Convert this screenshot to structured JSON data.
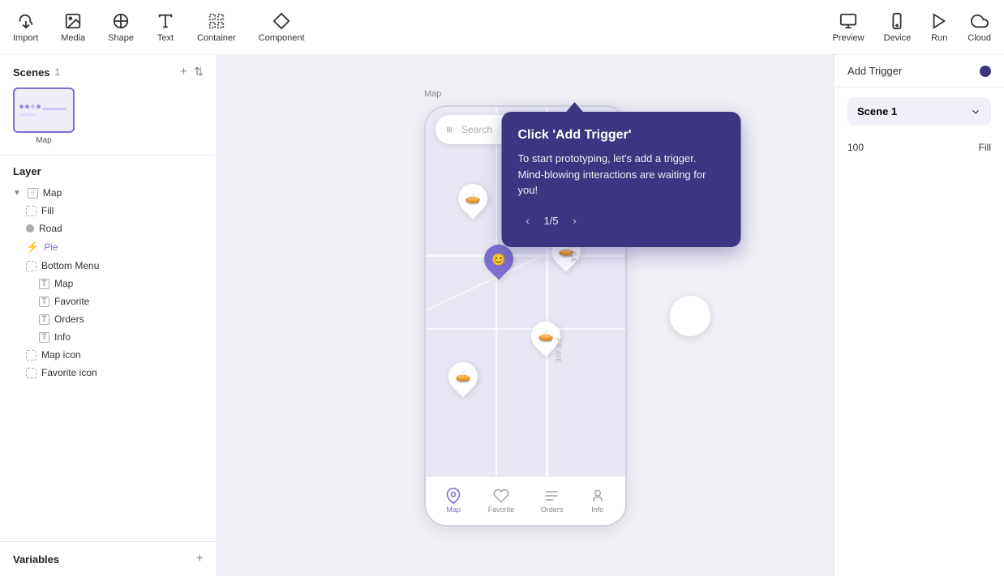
{
  "toolbar": {
    "import_label": "Import",
    "media_label": "Media",
    "shape_label": "Shape",
    "text_label": "Text",
    "container_label": "Container",
    "component_label": "Component",
    "preview_label": "Preview",
    "device_label": "Device",
    "run_label": "Run",
    "cloud_label": "Cloud"
  },
  "scenes": {
    "title": "Scenes",
    "count": "1",
    "scene_name": "Map"
  },
  "layer": {
    "title": "Layer",
    "items": [
      {
        "name": "Map",
        "indent": 0,
        "type": "frame"
      },
      {
        "name": "Fill",
        "indent": 1,
        "type": "frame-dotted"
      },
      {
        "name": "Road",
        "indent": 1,
        "type": "circle"
      },
      {
        "name": "Pie",
        "indent": 1,
        "type": "bolt",
        "active": true
      },
      {
        "name": "Bottom Menu",
        "indent": 1,
        "type": "frame-dotted"
      },
      {
        "name": "Map",
        "indent": 2,
        "type": "T"
      },
      {
        "name": "Favorite",
        "indent": 2,
        "type": "T"
      },
      {
        "name": "Orders",
        "indent": 2,
        "type": "T"
      },
      {
        "name": "Info",
        "indent": 2,
        "type": "T"
      },
      {
        "name": "Map icon",
        "indent": 1,
        "type": "frame-dotted"
      },
      {
        "name": "Favorite icon",
        "indent": 1,
        "type": "frame-dotted"
      }
    ]
  },
  "variables": {
    "title": "Variables"
  },
  "phone": {
    "search_placeholder": "Search",
    "nav_items": [
      {
        "label": "Map",
        "active": true
      },
      {
        "label": "Favorite",
        "active": false
      },
      {
        "label": "Orders",
        "active": false
      },
      {
        "label": "Info",
        "active": false
      }
    ]
  },
  "right_panel": {
    "trigger_label": "Add Trigger",
    "scene_label": "Scene 1",
    "fill_value": "100",
    "fill_label": "Fill"
  },
  "tooltip": {
    "title": "Click 'Add Trigger'",
    "body": "To start prototyping, let's add a trigger. Mind-blowing interactions are waiting for you!",
    "pagination": "1/5"
  }
}
